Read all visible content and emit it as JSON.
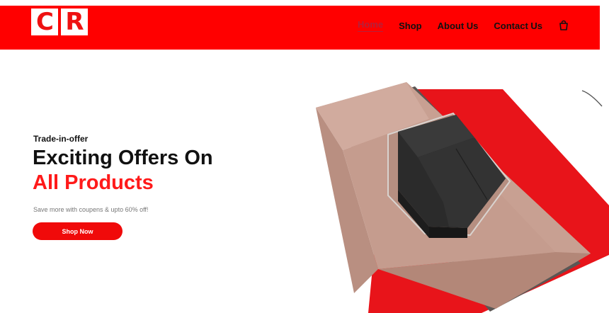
{
  "header": {
    "logo_letters": [
      "C",
      "R"
    ],
    "nav": [
      {
        "label": "Home",
        "active": true
      },
      {
        "label": "Shop",
        "active": false
      },
      {
        "label": "About Us",
        "active": false
      },
      {
        "label": "Contact Us",
        "active": false
      }
    ],
    "cart_icon": "shopping-bag-icon"
  },
  "hero": {
    "eyebrow": "Trade-in-offer",
    "title_line1": "Exciting Offers On",
    "title_line2": "All Products",
    "subtitle": "Save more with coupens & upto 60% off!",
    "cta_label": "Shop Now"
  },
  "colors": {
    "brand_red": "#ff0000",
    "accent_text": "#ff1a1a",
    "active_nav": "#b6203a"
  }
}
